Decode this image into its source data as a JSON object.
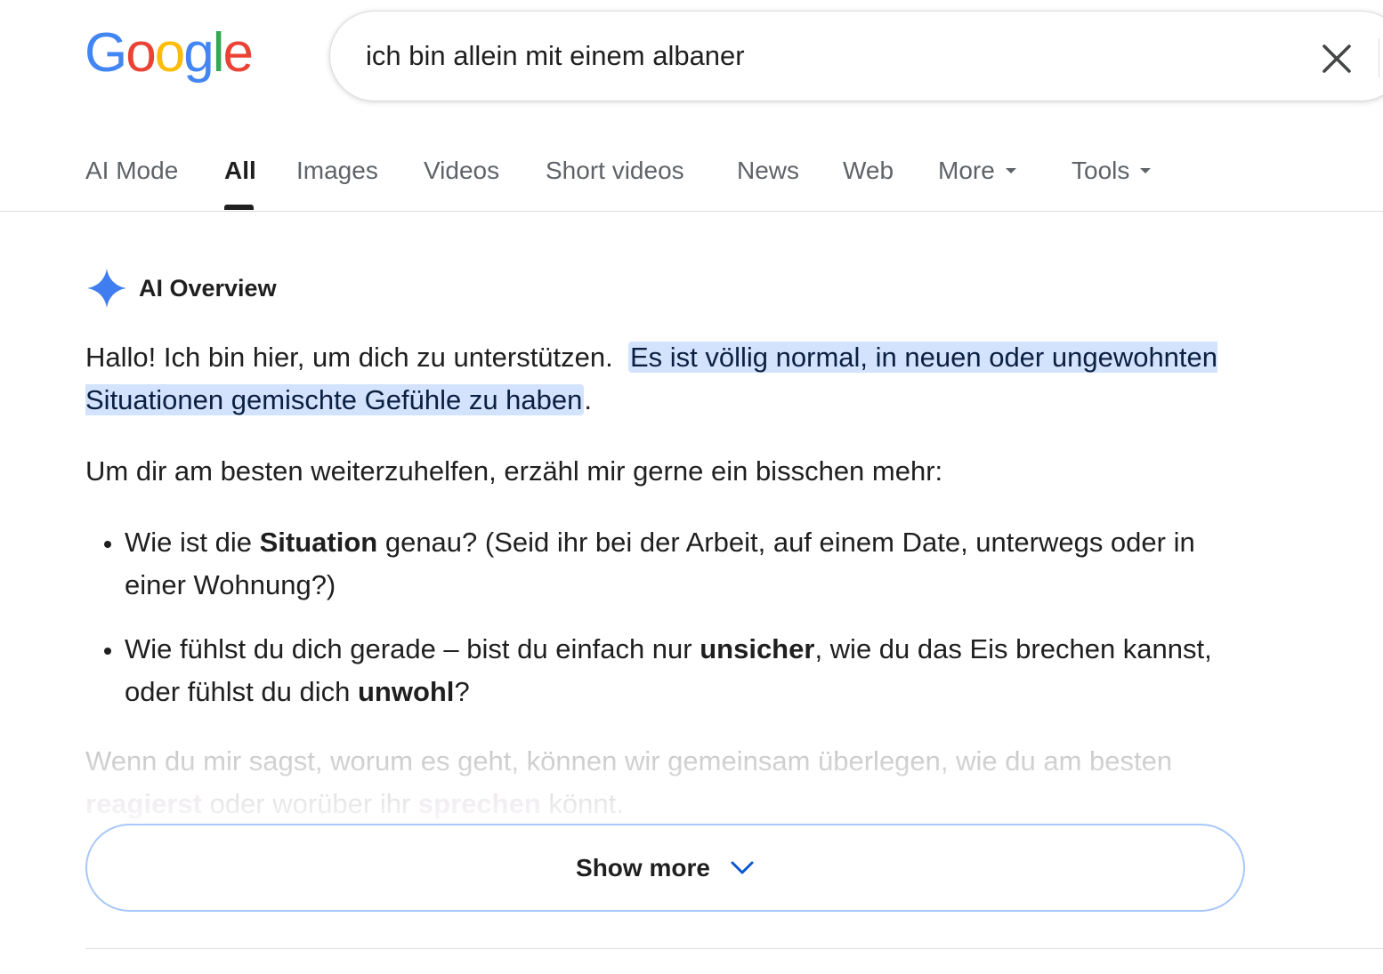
{
  "logo": {
    "letters": [
      "G",
      "o",
      "o",
      "g",
      "l",
      "e"
    ],
    "colors": [
      "#4285F4",
      "#EA4335",
      "#FBBC05",
      "#4285F4",
      "#34A853",
      "#EA4335"
    ]
  },
  "search": {
    "query": "ich bin allein mit einem albaner",
    "clear_icon": "close-icon"
  },
  "tabs": [
    {
      "label": "AI Mode",
      "active": false
    },
    {
      "label": "All",
      "active": true
    },
    {
      "label": "Images",
      "active": false
    },
    {
      "label": "Videos",
      "active": false
    },
    {
      "label": "Short videos",
      "active": false
    },
    {
      "label": "News",
      "active": false
    },
    {
      "label": "Web",
      "active": false
    },
    {
      "label": "More",
      "active": false,
      "has_caret": true
    },
    {
      "label": "Tools",
      "active": false,
      "has_caret": true
    }
  ],
  "ai_overview": {
    "icon": "sparkle-icon",
    "title": "AI Overview",
    "p1_plain": "Hallo! Ich bin hier, um dich zu unterstützen.",
    "p1_highlight": "Es ist völlig normal, in neuen oder ungewohnten Situationen gemischte Gefühle zu haben",
    "p1_end": ".",
    "p2": "Um dir am besten weiterzuhelfen, erzähl mir gerne ein bisschen mehr:",
    "bullets": [
      {
        "pre": "Wie ist die ",
        "bold": "Situation",
        "post": " genau? (Seid ihr bei der Arbeit, auf einem Date, unterwegs oder in einer Wohnung?)"
      },
      {
        "pre": "Wie fühlst du dich gerade – bist du einfach nur ",
        "bold": "unsicher",
        "mid": ", wie du das Eis brechen kannst, oder fühlst du dich ",
        "bold2": "unwohl",
        "post": "?"
      }
    ],
    "faded": {
      "pre": "Wenn du mir sagst, worum es geht, können wir gemeinsam überlegen, wie du am besten ",
      "bold": "reagierst",
      "mid": " oder worüber ihr ",
      "bold2": "sprechen",
      "post": " könnt."
    },
    "show_more_label": "Show more",
    "show_more_icon": "chevron-down-icon",
    "accent_color": "#a8c7fa",
    "highlight_color": "#d3e3fd"
  }
}
